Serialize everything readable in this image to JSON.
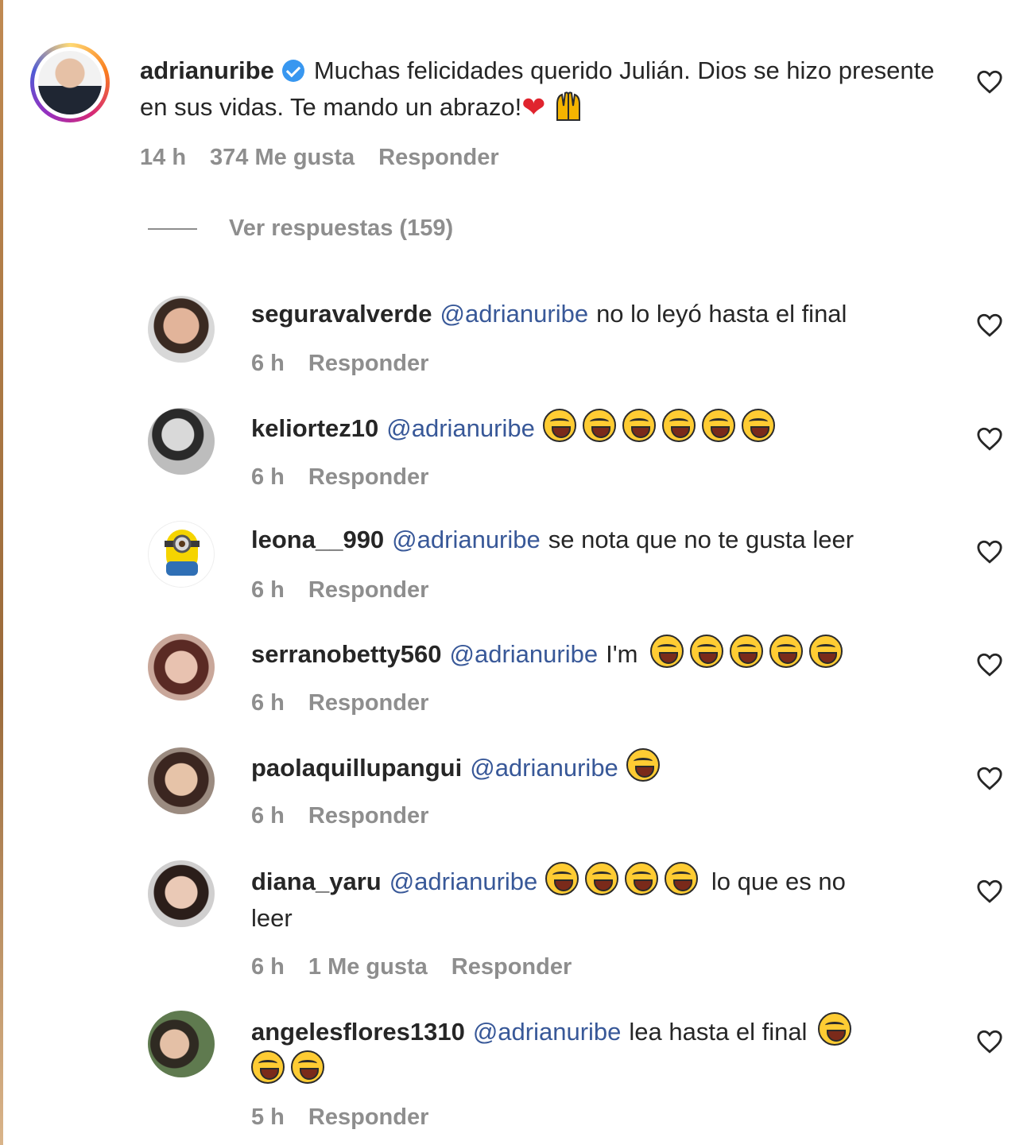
{
  "main_comment": {
    "username": "adrianuribe",
    "text": "Muchas felicidades querido Julián. Dios se hizo presente en sus vidas. Te mando un abrazo!",
    "emojis": [
      "red-heart-emoji",
      "raising-hands-emoji"
    ],
    "time": "14 h",
    "likes": "374 Me gusta",
    "reply_label": "Responder"
  },
  "view_replies": "Ver respuestas (159)",
  "replies": [
    {
      "username": "seguravalverde",
      "mention": "@adrianuribe",
      "text": "no lo leyó hasta el final",
      "time": "6 h",
      "likes": "",
      "reply_label": "Responder"
    },
    {
      "username": "keliortez10",
      "mention": "@adrianuribe",
      "text": "",
      "emoji_count": 6,
      "time": "6 h",
      "likes": "",
      "reply_label": "Responder"
    },
    {
      "username": "leona__990",
      "mention": "@adrianuribe",
      "text": "se nota que no te gusta leer",
      "time": "6 h",
      "likes": "",
      "reply_label": "Responder"
    },
    {
      "username": "serranobetty560",
      "mention": "@adrianuribe",
      "text": "I'm",
      "emoji_count": 5,
      "time": "6 h",
      "likes": "",
      "reply_label": "Responder"
    },
    {
      "username": "paolaquillupangui",
      "mention": "@adrianuribe",
      "text": "",
      "emoji_count": 1,
      "time": "6 h",
      "likes": "",
      "reply_label": "Responder"
    },
    {
      "username": "diana_yaru",
      "mention": "@adrianuribe",
      "text_before": "",
      "text_after": "lo que es no",
      "text_line2": "leer",
      "emoji_count": 4,
      "time": "6 h",
      "likes": "1 Me gusta",
      "reply_label": "Responder"
    },
    {
      "username": "angelesflores1310",
      "mention": "@adrianuribe",
      "text": "lea hasta el final",
      "emoji_count": 1,
      "emoji_line2_count": 2,
      "time": "5 h",
      "likes": "",
      "reply_label": "Responder"
    }
  ],
  "icons": {
    "like": "heart-outline-icon",
    "laugh": "face-with-tears-of-joy-emoji",
    "verified": "verified-badge-icon"
  }
}
